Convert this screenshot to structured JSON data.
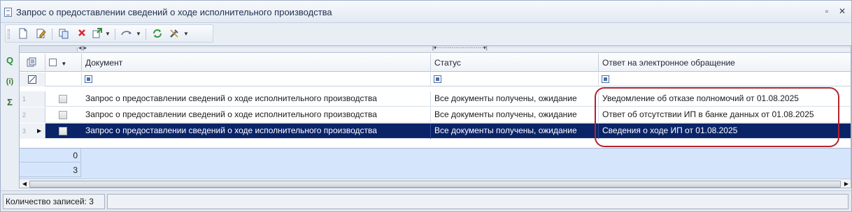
{
  "window": {
    "title": "Запрос о предоставлении сведений о ходе исполнительного производства",
    "restore_glyph": "▫",
    "close_glyph": "✕"
  },
  "toolbar": {
    "icons": [
      "new-document-icon",
      "edit-document-icon",
      "copy-icon",
      "delete-icon",
      "create-based-on-icon",
      "actions-icon",
      "refresh-icon",
      "tools-icon"
    ]
  },
  "leftstrip": {
    "search_glyph": "Q",
    "info_glyph": "(i)",
    "sum_glyph": "Σ"
  },
  "grid": {
    "columns": {
      "document": "Документ",
      "status": "Статус",
      "response": "Ответ на электронное обращение"
    },
    "rows": [
      {
        "num": "1",
        "document": "Запрос о предоставлении сведений о ходе исполнительного производства",
        "status": "Все документы получены, ожидание",
        "response": "Уведомление об отказе полномочий от 01.08.2025"
      },
      {
        "num": "2",
        "document": "Запрос о предоставлении сведений о ходе исполнительного производства",
        "status": "Все документы получены, ожидание",
        "response": "Ответ об отсутствии ИП в банке данных от 01.08.2025"
      },
      {
        "num": "3",
        "document": "Запрос о предоставлении сведений о ходе исполнительного производства",
        "status": "Все документы получены, ожидание",
        "response": "Сведения о ходе ИП от 01.08.2025"
      }
    ],
    "selected_row": 3,
    "summary": [
      "0",
      "3"
    ]
  },
  "statusbar": {
    "record_count": "Количество записей: 3"
  },
  "colors": {
    "selection": "#0b2468",
    "highlight": "#b3232e",
    "summary_bg": "#d5e5fb"
  }
}
